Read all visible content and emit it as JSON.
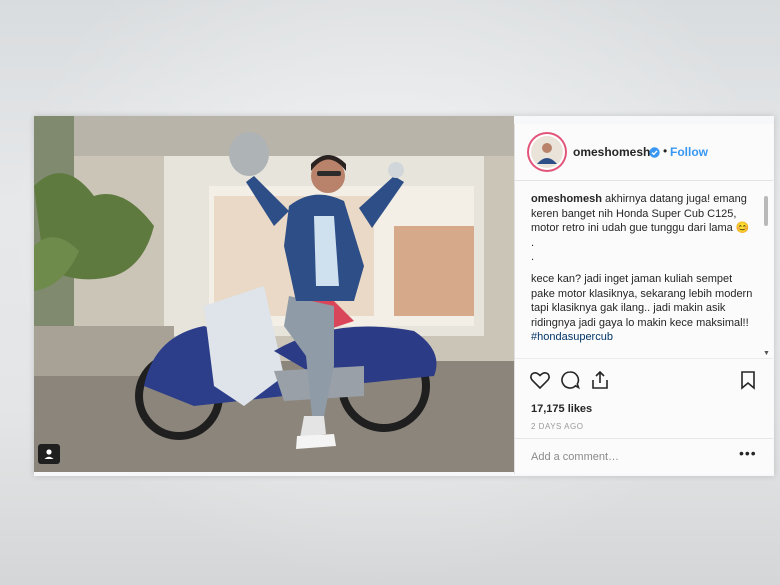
{
  "post": {
    "username": "omeshomesh",
    "follow_label": "Follow",
    "separator": "•",
    "caption": {
      "username": "omeshomesh",
      "line1": "akhirnya datang juga!",
      "line2": "emang keren banget nih Honda Super Cub C125, motor retro ini udah gue tunggu dari lama 😊",
      "dot1": ".",
      "dot2": ".",
      "line3": "kece kan? jadi inget jaman kuliah sempet pake motor klasiknya, sekarang lebih modern tapi klasiknya gak ilang.. jadi makin asik ridingnya jadi gaya lo makin kece maksimal!!",
      "hashtag": "#hondasupercub"
    },
    "likes": "17,175 likes",
    "timestamp": "2 DAYS AGO",
    "comment_placeholder": "Add a comment…",
    "more_label": "•••",
    "icons": {
      "like": "heart-icon",
      "comment": "comment-icon",
      "share": "share-icon",
      "save": "bookmark-icon",
      "verified": "verified-badge-icon",
      "user_tag": "user-tag-icon"
    }
  }
}
